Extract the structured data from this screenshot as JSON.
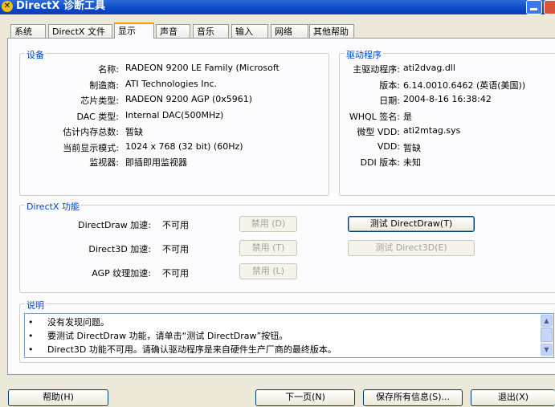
{
  "window": {
    "title": "DirectX 诊断工具",
    "colors": {
      "titlebar": "#0a49c8",
      "group_title": "#0046d5",
      "tab_highlight": "#ff9a00",
      "background": "#ece9d8"
    }
  },
  "tabs": [
    "系统",
    "DirectX 文件",
    "显示",
    "声音",
    "音乐",
    "输入",
    "网络",
    "其他帮助"
  ],
  "active_tab": "显示",
  "device": {
    "title": "设备",
    "rows": [
      {
        "label": "名称:",
        "value": "RADEON 9200 LE Family (Microsoft"
      },
      {
        "label": "制造商:",
        "value": "ATI Technologies Inc."
      },
      {
        "label": "芯片类型:",
        "value": "RADEON 9200 AGP (0x5961)"
      },
      {
        "label": "DAC 类型:",
        "value": "Internal DAC(500MHz)"
      },
      {
        "label": "估计内存总数:",
        "value": "暂缺"
      },
      {
        "label": "当前显示模式:",
        "value": "1024 x 768 (32 bit) (60Hz)"
      },
      {
        "label": "监视器:",
        "value": "即插即用监视器"
      }
    ]
  },
  "driver": {
    "title": "驱动程序",
    "rows": [
      {
        "label": "主驱动程序:",
        "value": "ati2dvag.dll"
      },
      {
        "label": "版本:",
        "value": "6.14.0010.6462 (英语(美国))"
      },
      {
        "label": "日期:",
        "value": "2004-8-16 16:38:42"
      },
      {
        "label": "WHQL 签名:",
        "value": "是"
      },
      {
        "label": "微型 VDD:",
        "value": "ati2mtag.sys"
      },
      {
        "label": "VDD:",
        "value": "暂缺"
      },
      {
        "label": "DDI 版本:",
        "value": "未知"
      }
    ]
  },
  "directx_features": {
    "title": "DirectX 功能",
    "rows": [
      {
        "label": "DirectDraw 加速:",
        "value": "不可用",
        "button": "禁用 (D)"
      },
      {
        "label": "Direct3D 加速:",
        "value": "不可用",
        "button": "禁用 (T)"
      },
      {
        "label": "AGP 纹理加速:",
        "value": "不可用",
        "button": "禁用 (L)"
      }
    ],
    "test_directdraw": "测试 DirectDraw(T)",
    "test_direct3d": "测试 Direct3D(E)"
  },
  "notes": {
    "title": "说明",
    "bullet": "•",
    "lines": [
      "没有发现问题。",
      "要测试 DirectDraw 功能，请单击“测试 DirectDraw”按钮。",
      "Direct3D 功能不可用。请确认驱动程序是来自硬件生产厂商的最终版本。"
    ]
  },
  "bottom_buttons": {
    "help": "帮助(H)",
    "next_page": "下一页(N)",
    "save_all": "保存所有信息(S)...",
    "exit": "退出(X)"
  }
}
